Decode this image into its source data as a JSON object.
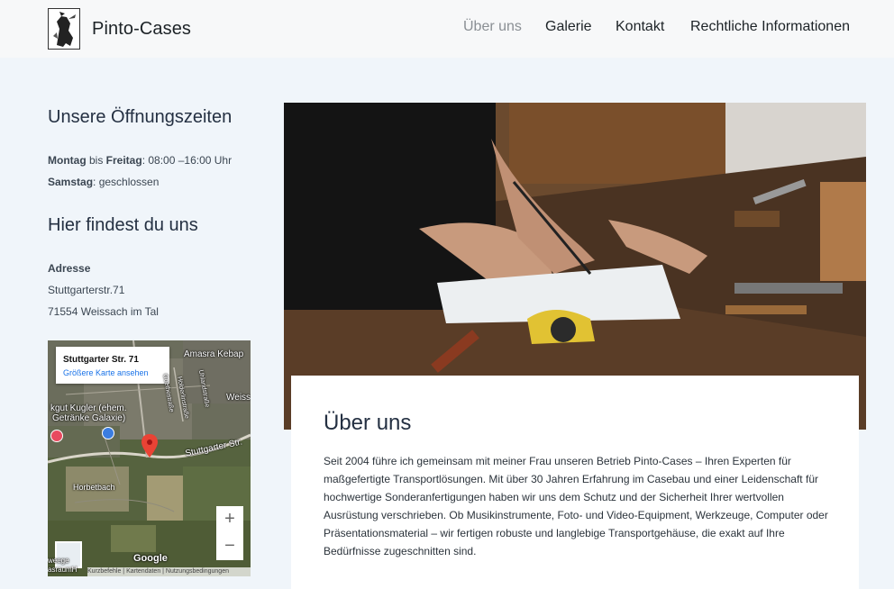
{
  "header": {
    "brand": "Pinto-Cases",
    "nav": [
      "Über uns",
      "Galerie",
      "Kontakt",
      "Rechtliche Informationen"
    ]
  },
  "sidebar": {
    "hours_heading": "Unsere Öffnungszeiten",
    "hours_line1_day1": "Montag",
    "hours_line1_mid": " bis ",
    "hours_line1_day2": "Freitag",
    "hours_line1_time": ": 08:00 –16:00 Uhr",
    "hours_line2_day": "Samstag",
    "hours_line2_value": ": geschlossen",
    "find_heading": "Hier findest du uns",
    "address_label": "Adresse",
    "street": "Stuttgarterstr.71",
    "city": "71554 Weissach im Tal"
  },
  "map": {
    "card_title": "Stuttgarter Str. 71",
    "card_link": "Größere Karte ansehen",
    "labels": [
      "Amasra Kebap",
      "Weiss",
      "kgut Kugler (ehem.",
      "Getränke Galaxie)",
      "Stuttgarter Str.",
      "Horbetbach",
      "Google"
    ],
    "street_names": [
      "Goethestraße",
      "Uhlandstraße",
      "Hölderlinstraße"
    ],
    "zoom_in": "+",
    "zoom_out": "−",
    "footer": "Kurzbefehle  |  Kartendaten  |  Nutzungsbedingungen",
    "edge_text": "weege",
    "edge_text2": "asraumH"
  },
  "main": {
    "heading": "Über uns",
    "body": "Seit 2004 führe ich gemeinsam mit meiner Frau unseren Betrieb Pinto-Cases – Ihren Experten für maßgefertigte Transportlösungen. Mit über 30 Jahren Erfahrung im Casebau und einer Leidenschaft für hochwertige Sonderanfertigungen haben wir uns dem Schutz und der Sicherheit Ihrer wertvollen Ausrüstung verschrieben. Ob Musikinstrumente, Foto- und Video-Equipment, Werkzeuge, Computer oder Präsentationsmaterial – wir fertigen robuste und langlebige Transportgehäuse, die exakt auf Ihre Bedürfnisse zugeschnitten sind."
  },
  "colors": {
    "page_bg": "#f0f5fa",
    "header_bg": "#f7f8f9",
    "nav_active": "#8a8f94",
    "heading": "#243042",
    "map_link": "#1a73e8",
    "map_pin": "#ea4335"
  },
  "icons": [
    "logo-icon",
    "map-pin-icon",
    "map-satellite-thumbnail-icon",
    "map-poi-icon"
  ]
}
